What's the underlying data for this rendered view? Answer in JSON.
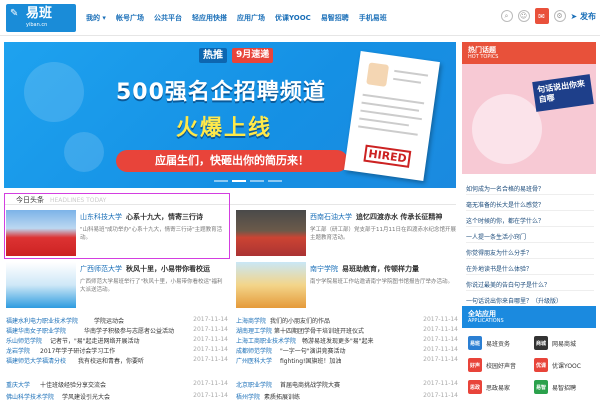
{
  "header": {
    "logo_title": "易班",
    "logo_sub": "yiban.cn",
    "nav": [
      "我的 ▾",
      "帐号广场",
      "公共平台",
      "轻应用快搭",
      "应用广场",
      "优课YOOC",
      "易智招聘",
      "手机易班"
    ],
    "publish_label": "发布"
  },
  "banner": {
    "tag_hot": "热推",
    "tag_date": "9月速递",
    "title": "500强名企招聘频道",
    "subtitle": "火爆上线",
    "pill": "应届生们，快砸出你的简历来！",
    "stamp": "HIRED"
  },
  "headlines": {
    "title": "今日头条",
    "title_en": "HEADLINES TODAY",
    "cards": [
      {
        "school": "山东科技大学",
        "title": "心系十九大，情寄三行诗",
        "desc": "\"山科易班\"成功举办\"心系十九大，情寄三行诗\"主题教育活动。"
      },
      {
        "school": "西南石油大学",
        "title": "追忆四渡赤水 传承长征精神",
        "desc": "学工部（研工部）党支部于11月11日在四渡赤水纪念馆开展主题教育活动。"
      },
      {
        "school": "广西师范大学",
        "title": "秋风十里，小易带你看校运",
        "desc": "广西师范大学易班举行了\"秋风十里，小易带你看校运\"福利大派送活动。"
      },
      {
        "school": "南宁学院",
        "title": "易班助教育，传顿样力量",
        "desc": "南宁学院易班工作站邀请南宁学院图书馆报告厅举办活动。"
      }
    ],
    "news_left": [
      {
        "school": "福建水利电力职业技术学院",
        "text": "学院运动会",
        "date": "2017-11-14"
      },
      {
        "school": "福建华南女子职业学院",
        "text": "华南学子积极参与志愿者公益活动",
        "date": "2017-11-14"
      },
      {
        "school": "乐山师范学院",
        "text": "记者节，\"易\"起走进网络开展活动",
        "date": "2017-11-14"
      },
      {
        "school": "龙岩学院",
        "text": "2017年学子研讨会学习工作",
        "date": "2017-11-14"
      },
      {
        "school": "福建师范大学福清分校",
        "text": "我有校运和青春，你要听",
        "date": "2017-11-14"
      },
      {
        "school": "重庆大学",
        "text": "十佳班级经验分享交流会",
        "date": "2017-11-14"
      },
      {
        "school": "佛山科学技术学院",
        "text": "学风建设引光大会",
        "date": "2017-11-14"
      }
    ],
    "news_right": [
      {
        "school": "上海商学院",
        "text": "我们的小朋友们的作品",
        "date": "2017-11-14"
      },
      {
        "school": "湖南理工学院",
        "text": "第十四期团学骨干培训班开班仪式",
        "date": "2017-11-14"
      },
      {
        "school": "上海工商职业技术学院",
        "text": "畅游易班发现更多\"易\"起来",
        "date": "2017-11-14"
      },
      {
        "school": "成都师范学院",
        "text": "\"一字一句\"演讲竞赛活动",
        "date": "2017-11-14"
      },
      {
        "school": "广州医科大学",
        "text": "fighting!国旗班！加油",
        "date": "2017-11-14"
      },
      {
        "school": "北京职业学院",
        "text": "首届电商挑战学院大赛",
        "date": "2017-11-14"
      },
      {
        "school": "梧州学院",
        "text": "素质拓展训练",
        "date": "2017-11-14"
      }
    ]
  },
  "sidebar": {
    "hot_title": "热门话题",
    "hot_title_en": "HOT TOPICS",
    "hot_img_text": "句话说出你来自哪",
    "topics": [
      "如何成为一名合格的易班骨？",
      "毫无准备的长大是什么感觉？",
      "这个时候的你，都在学什么？",
      "一人提一条生活小窍门",
      "你觉得朋友为什么分手？",
      "在外地读书是什么体验？",
      "你说过最美的告白句子是什么？",
      "一句话说出你来自哪里？（升级版）"
    ],
    "apps_title": "全站应用",
    "apps_title_en": "APPLICATIONS",
    "apps": [
      {
        "label": "易班贡务",
        "icon": "易班",
        "color": "#2b7fd3"
      },
      {
        "label": "网易商城",
        "icon": "商城",
        "color": "#333333"
      },
      {
        "label": "校园好声音",
        "icon": "好声",
        "color": "#e8443a"
      },
      {
        "label": "优课YOOC",
        "icon": "优课",
        "color": "#e8443a"
      },
      {
        "label": "思政易家",
        "icon": "思政",
        "color": "#e8443a"
      },
      {
        "label": "易智招聘",
        "icon": "易智",
        "color": "#2ba14c"
      }
    ]
  }
}
